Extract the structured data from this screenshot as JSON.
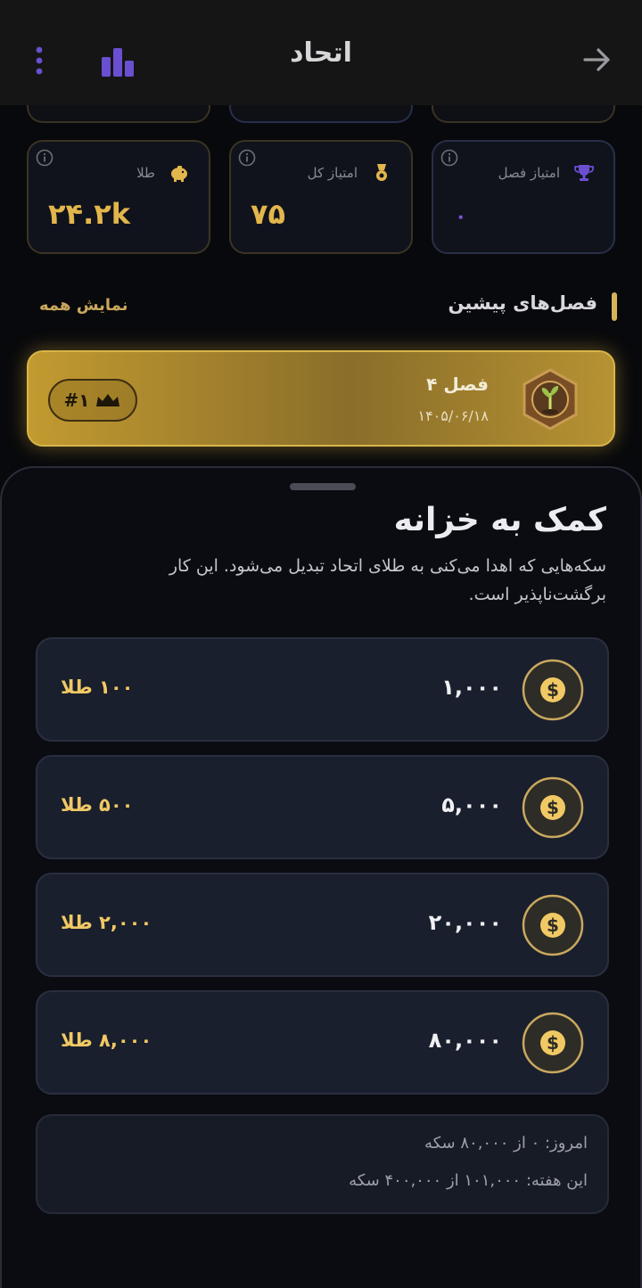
{
  "header": {
    "title": "اتحاد"
  },
  "stats": [
    {
      "label": "طلا",
      "value": "۲۴.۲k",
      "icon": "piggy-bank-icon"
    },
    {
      "label": "امتیاز کل",
      "value": "۷۵",
      "icon": "medal-icon"
    },
    {
      "label": "امتیاز فصل",
      "value": "۰",
      "icon": "trophy-icon"
    }
  ],
  "previous_seasons": {
    "title": "فصل‌های پیشین",
    "show_all": "نمایش همه",
    "season": {
      "name": "فصل ۴",
      "date": "۱۴۰۵/۰۶/۱۸",
      "rank": "#۱"
    }
  },
  "treasury": {
    "title": "کمک به خزانه",
    "description": "سکه‌هایی که اهدا می‌کنی به طلای اتحاد تبدیل می‌شود. این کار برگشت‌ناپذیر است.",
    "options": [
      {
        "amount": "۱,۰۰۰",
        "gold": "۱۰۰ طلا"
      },
      {
        "amount": "۵,۰۰۰",
        "gold": "۵۰۰ طلا"
      },
      {
        "amount": "۲۰,۰۰۰",
        "gold": "۲,۰۰۰ طلا"
      },
      {
        "amount": "۸۰,۰۰۰",
        "gold": "۸,۰۰۰ طلا"
      }
    ],
    "today": "امروز: ۰ از ۸۰,۰۰۰ سکه",
    "week": "این هفته: ۱۰۱,۰۰۰ از ۴۰۰,۰۰۰ سکه"
  },
  "colors": {
    "accent_gold": "#e3b64c",
    "accent_purple": "#6a4fd0",
    "background": "#08090c"
  }
}
